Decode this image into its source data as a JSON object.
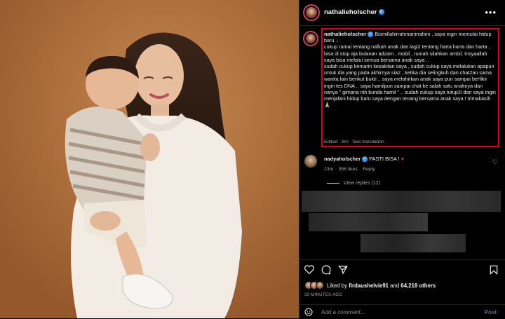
{
  "post": {
    "username": "nathalieholscher",
    "image_alt": "Photo of a mother holding her son who kisses her cheek against an orange backdrop"
  },
  "caption": {
    "username": "nathalieholscher",
    "text": "Bismillahirrahmanirrahim , saya ingin memulai hidup baru ..\ncukup ramai tentang nafkah anak dan lagi2 tentang harta harta dan harta .. bisa di stop aja bulanan adzam , mobil , rumah silahkan ambil. Insyaallah saya bisa melalui semua bersama anak saya ..\nsudah cukup kemarin kesakitan saya , sudah cukup saya melalukan apapun untuk dia yang pada akhirnya sia2 , ketika dia selingkuh dan chat2an sama wanita lain berikut bukti .. saya melahirkan anak saya pun sampai berfikir ingin tes DNA .. saya hamilpun sampai chat ke salah satu anaknya dan nanya \" gimana nih bunda hamil \" .. sudah cukup saya tutup2i dan saya ingin menjalani hidup baru saya dengan tenang bersama anak saya ! trimakasih 🙏",
    "edited": "Edited · 8m",
    "see_translation": "See translation"
  },
  "comment": {
    "username": "nadyaholscher",
    "text": "PASTI BISA !",
    "time": "23m",
    "likes": "356 likes",
    "reply": "Reply"
  },
  "view_replies": "View replies (12)",
  "likes_line": {
    "prefix": "Liked by",
    "user": "firdaushelvie91",
    "middle": "and",
    "count": "64,218 others"
  },
  "time_ago": "33 MINUTES AGO",
  "add_comment": {
    "placeholder": "Add a comment...",
    "post_label": "Post"
  },
  "colors": {
    "highlight_border": "#e0001a",
    "verified": "#3897f0",
    "background": "#000000"
  }
}
